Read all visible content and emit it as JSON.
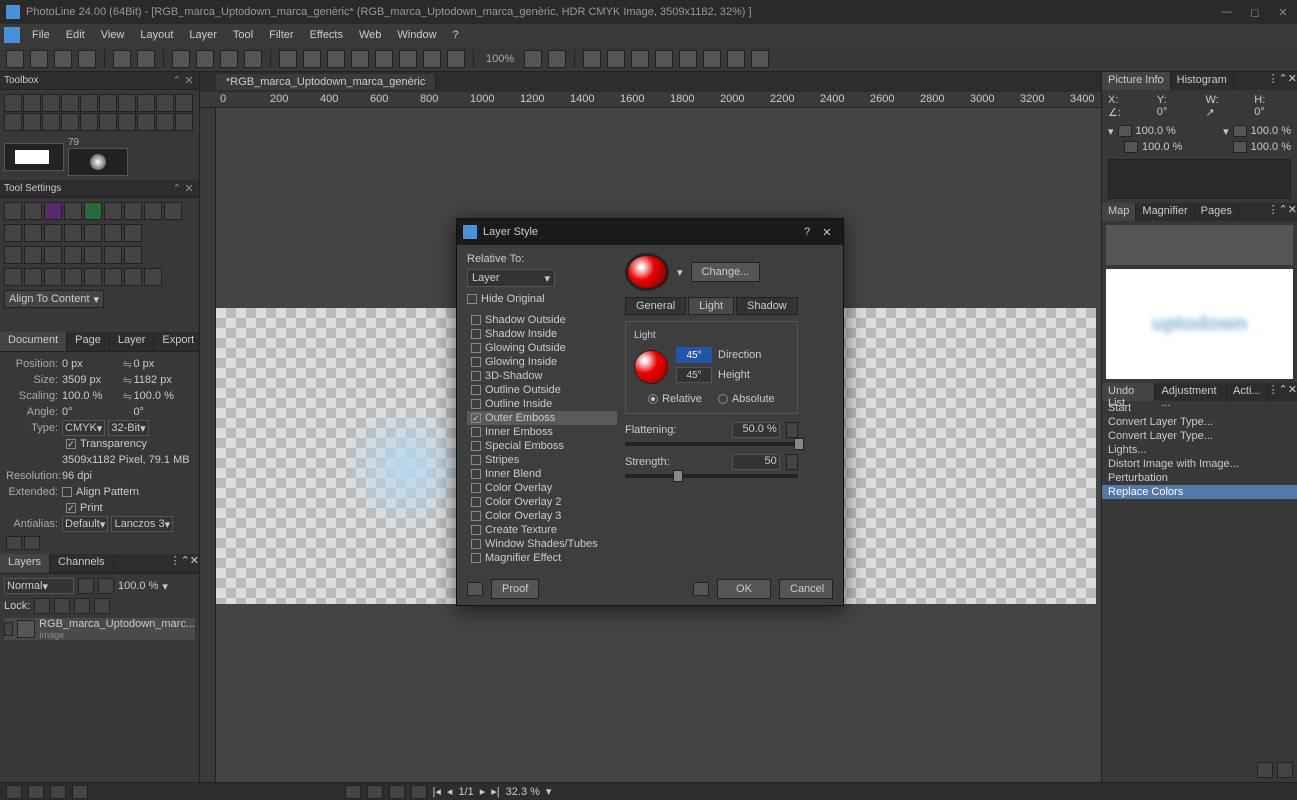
{
  "titlebar": {
    "text": "PhotoLine 24.00 (64Bit) - [RGB_marca_Uptodown_marca_genèric* (RGB_marca_Uptodown_marca_genèric, HDR CMYK Image, 3509x1182, 32%) ]"
  },
  "menu": [
    "File",
    "Edit",
    "View",
    "Layout",
    "Layer",
    "Tool",
    "Filter",
    "Effects",
    "Web",
    "Window",
    "?"
  ],
  "toolbar_zoom": "100%",
  "left": {
    "toolbox_title": "Toolbox",
    "tool_settings_title": "Tool Settings",
    "swatch_num": "79",
    "align_label": "Align To Content",
    "doc_tabs": [
      "Document",
      "Page",
      "Layer",
      "Export"
    ],
    "doc": {
      "position_lbl": "Position:",
      "pos_x": "0 px",
      "pos_y": "0 px",
      "size_lbl": "Size:",
      "size_w": "3509 px",
      "size_h": "1182 px",
      "scaling_lbl": "Scaling:",
      "scale_x": "100.0 %",
      "scale_y": "100.0 %",
      "angle_lbl": "Angle:",
      "angle_a": "0°",
      "angle_b": "0°",
      "type_lbl": "Type:",
      "type_mode": "CMYK",
      "type_depth": "32-Bit",
      "transparency": "Transparency",
      "dims": "3509x1182 Pixel, 79.1 MB",
      "res_lbl": "Resolution:",
      "res_val": "96 dpi",
      "ext_lbl": "Extended:",
      "align_pattern": "Align Pattern",
      "print": "Print",
      "antialias_lbl": "Antialias:",
      "antialias_val": "Default",
      "lanczos": "Lanczos 3"
    },
    "layers_tabs": [
      "Layers",
      "Channels"
    ],
    "blend_mode": "Normal",
    "opacity": "100.0 %",
    "lock_lbl": "Lock:",
    "layer_name": "RGB_marca_Uptodown_marc...",
    "layer_sub": "Image"
  },
  "center": {
    "doc_tab": "*RGB_marca_Uptodown_marca_genèric",
    "ruler_marks": [
      "0",
      "200",
      "400",
      "600",
      "800",
      "1000",
      "1200",
      "1400",
      "1600",
      "1800",
      "2000",
      "2200",
      "2400",
      "2600",
      "2800",
      "3000",
      "3200",
      "3400"
    ]
  },
  "right": {
    "info_tabs": [
      "Picture Info",
      "Histogram"
    ],
    "coords": {
      "x": "X:",
      "y": "Y:",
      "w": "W:",
      "h": "H:"
    },
    "angle_sym": "∠:",
    "angle_val": "0°",
    "orient": "0°",
    "pct": "100.0 %",
    "map_tabs": [
      "Map",
      "Magnifier",
      "Pages"
    ],
    "preview_text": "uptodown",
    "undo_tabs": [
      "Undo List",
      "Adjustment ...",
      "Acti..."
    ],
    "undo_items": [
      "Start",
      "Convert Layer Type...",
      "Convert Layer Type...",
      "Lights...",
      "Distort Image with Image...",
      "Perturbation",
      "Replace Colors"
    ]
  },
  "statusbar": {
    "page": "1/1",
    "zoom": "32.3 %"
  },
  "dialog": {
    "title": "Layer Style",
    "relative_lbl": "Relative To:",
    "relative_val": "Layer",
    "hide_original": "Hide Original",
    "change_btn": "Change...",
    "effects": [
      {
        "label": "Shadow Outside",
        "on": false
      },
      {
        "label": "Shadow Inside",
        "on": false
      },
      {
        "label": "Glowing Outside",
        "on": false
      },
      {
        "label": "Glowing Inside",
        "on": false
      },
      {
        "label": "3D-Shadow",
        "on": false
      },
      {
        "label": "Outline Outside",
        "on": false
      },
      {
        "label": "Outline Inside",
        "on": false
      },
      {
        "label": "Outer Emboss",
        "on": true,
        "sel": true
      },
      {
        "label": "Inner Emboss",
        "on": false
      },
      {
        "label": "Special Emboss",
        "on": false
      },
      {
        "label": "Stripes",
        "on": false
      },
      {
        "label": "Inner Blend",
        "on": false
      },
      {
        "label": "Color Overlay",
        "on": false
      },
      {
        "label": "Color Overlay 2",
        "on": false
      },
      {
        "label": "Color Overlay 3",
        "on": false
      },
      {
        "label": "Create Texture",
        "on": false
      },
      {
        "label": "Window Shades/Tubes",
        "on": false
      },
      {
        "label": "Magnifier Effect",
        "on": false
      }
    ],
    "tabs": [
      "General",
      "Light",
      "Shadow"
    ],
    "light_title": "Light",
    "direction_val": "45°",
    "direction_lbl": "Direction",
    "height_val": "45°",
    "height_lbl": "Height",
    "relative_radio": "Relative",
    "absolute_radio": "Absolute",
    "flattening_lbl": "Flattening:",
    "flattening_val": "50.0 %",
    "strength_lbl": "Strength:",
    "strength_val": "50",
    "proof_btn": "Proof",
    "ok_btn": "OK",
    "cancel_btn": "Cancel"
  }
}
